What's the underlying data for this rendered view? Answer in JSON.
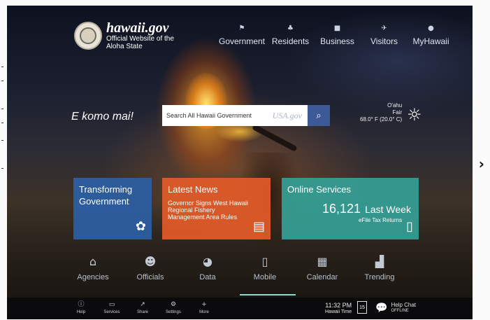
{
  "brand": {
    "site": "hawaii.gov",
    "tagline_1": "Official Website of the",
    "tagline_2": "Aloha State"
  },
  "nav": [
    {
      "label": "Government",
      "icon": "flag-icon"
    },
    {
      "label": "Residents",
      "icon": "residents-icon"
    },
    {
      "label": "Business",
      "icon": "briefcase-icon"
    },
    {
      "label": "Visitors",
      "icon": "airplane-icon"
    },
    {
      "label": "MyHawaii",
      "icon": "person-icon"
    }
  ],
  "welcome": "E komo mai!",
  "search": {
    "placeholder": "Search All Hawaii Government",
    "partner": "USA.gov"
  },
  "weather": {
    "location": "O'ahu",
    "condition": "Fair",
    "temp": "68.0° F (20.0° C)",
    "icon": "sun-icon"
  },
  "tiles": {
    "transforming": {
      "title_1": "Transforming",
      "title_2": "Government"
    },
    "news": {
      "title": "Latest News",
      "headline": "Governor Signs West Hawaii Regional Fishery Management Area Rules"
    },
    "online": {
      "title": "Online Services",
      "count": "16,121",
      "period": "Last Week",
      "sub": "eFile Tax Returns"
    }
  },
  "quicklinks": [
    {
      "label": "Agencies",
      "icon": "building-icon"
    },
    {
      "label": "Officials",
      "icon": "people-icon"
    },
    {
      "label": "Data",
      "icon": "pie-icon"
    },
    {
      "label": "Mobile",
      "icon": "mobile-icon"
    },
    {
      "label": "Calendar",
      "icon": "calendar-icon"
    },
    {
      "label": "Trending",
      "icon": "chart-icon"
    }
  ],
  "bottom": {
    "items": [
      {
        "label": "Help",
        "icon": "info-icon"
      },
      {
        "label": "Services",
        "icon": "monitor-icon"
      },
      {
        "label": "Share",
        "icon": "share-icon"
      },
      {
        "label": "Settings",
        "icon": "gear-icon"
      },
      {
        "label": "More",
        "icon": "plus-icon"
      }
    ],
    "time": "11:32 PM",
    "timezone": "Hawaii Time",
    "calendar_day": "15",
    "chat_label": "Help Chat",
    "chat_status": "OFFLINE"
  },
  "colors": {
    "news": "#de5a28",
    "transforming": "#2d5fa5",
    "online": "#34a096",
    "search_button": "#3d5a98"
  }
}
